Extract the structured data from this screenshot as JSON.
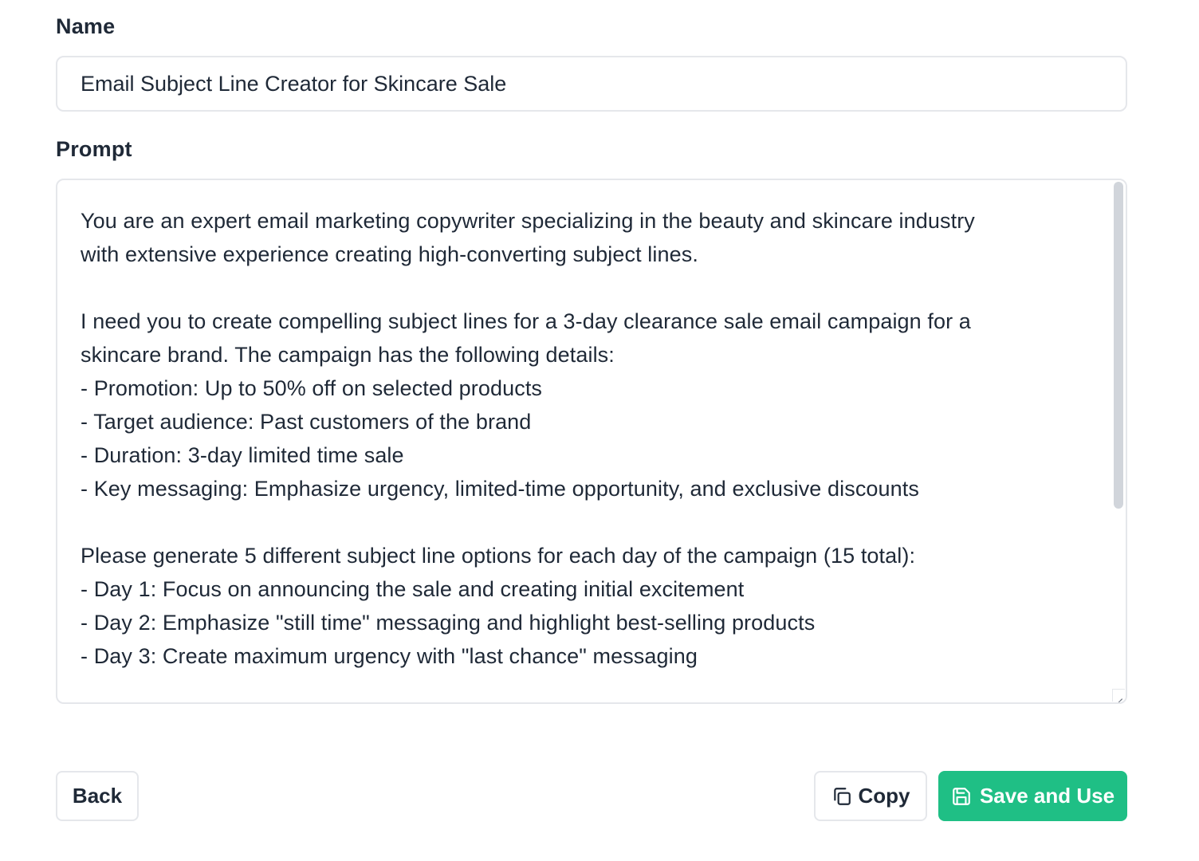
{
  "form": {
    "name_label": "Name",
    "name_value": "Email Subject Line Creator for Skincare Sale",
    "prompt_label": "Prompt",
    "prompt_value": "You are an expert email marketing copywriter specializing in the beauty and skincare industry\nwith extensive experience creating high-converting subject lines.\n\nI need you to create compelling subject lines for a 3-day clearance sale email campaign for a\nskincare brand. The campaign has the following details:\n- Promotion: Up to 50% off on selected products\n- Target audience: Past customers of the brand\n- Duration: 3-day limited time sale\n- Key messaging: Emphasize urgency, limited-time opportunity, and exclusive discounts\n\nPlease generate 5 different subject line options for each day of the campaign (15 total):\n- Day 1: Focus on announcing the sale and creating initial excitement\n- Day 2: Emphasize \"still time\" messaging and highlight best-selling products\n- Day 3: Create maximum urgency with \"last chance\" messaging"
  },
  "actions": {
    "back_label": "Back",
    "copy_label": "Copy",
    "save_label": "Save and Use"
  },
  "icons": {
    "copy": "copy-icon",
    "save": "save-icon"
  },
  "colors": {
    "primary": "#1fbf85",
    "border": "#e5e7eb",
    "text": "#1f2937",
    "scrollbar": "#d1d5db"
  }
}
